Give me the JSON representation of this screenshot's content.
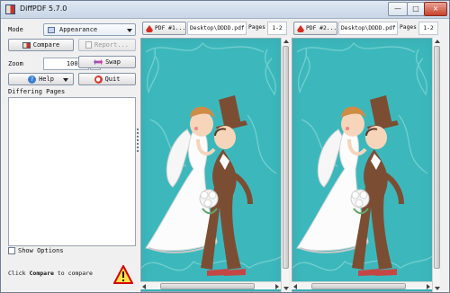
{
  "app": {
    "title": "DiffPDF 5.7.0",
    "window_buttons": {
      "minimize": "—",
      "maximize": "□",
      "close": "×"
    }
  },
  "left_panel": {
    "mode_label": "Mode",
    "mode_value": "Appearance",
    "compare_label": "Compare",
    "report_label": "Report...",
    "zoom_label": "Zoom",
    "zoom_value": "100 %",
    "swap_label": "Swap",
    "help_label": "Help",
    "quit_label": "Quit",
    "differing_pages_label": "Differing Pages",
    "show_options_label": "Show Options"
  },
  "status": {
    "prefix": "Click",
    "emphasis": "Compare",
    "suffix": "to compare"
  },
  "panels": [
    {
      "pdf_button": "PDF #1...",
      "file_path": "Desktop\\DDDD.pdf",
      "pages_label": "Pages",
      "pages_value": "1-2"
    },
    {
      "pdf_button": "PDF #2...",
      "file_path": "Desktop\\DDDD.pdf",
      "pages_label": "Pages",
      "pages_value": "1-2"
    }
  ],
  "colors": {
    "viewer_background": "#3cb8bc",
    "accent_red": "#c4352f",
    "window_background": "#f0f0f0"
  },
  "icons": {
    "app": "diffpdf-logo-icon",
    "compare": "compare-icon",
    "report": "report-icon",
    "swap": "swap-icon",
    "help": "help-icon",
    "quit": "quit-icon",
    "warning": "warning-icon",
    "pdf": "pdf-icon"
  }
}
